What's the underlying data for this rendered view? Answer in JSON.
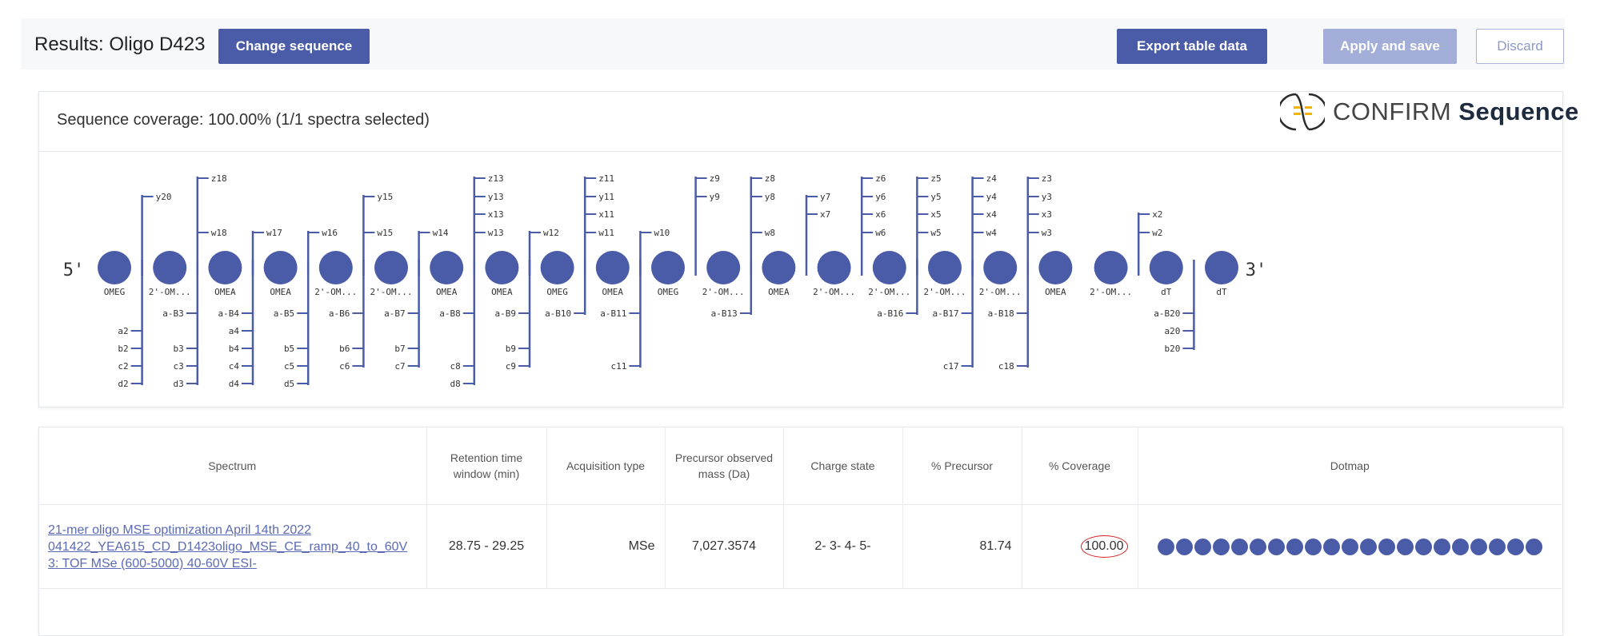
{
  "header": {
    "title": "Results: Oligo D423",
    "change_sequence_label": "Change sequence",
    "export_label": "Export table data",
    "apply_label": "Apply and save",
    "discard_label": "Discard"
  },
  "coverage": {
    "title": "Sequence coverage: 100.00% (1/1 spectra selected)",
    "end5": "5'",
    "end3": "3'"
  },
  "logo": {
    "word1": "CONFIRM",
    "word2": "Sequence"
  },
  "nucleotides": [
    {
      "label": "OMEG"
    },
    {
      "label": "2'-OM..."
    },
    {
      "label": "OMEA"
    },
    {
      "label": "OMEA"
    },
    {
      "label": "2'-OM..."
    },
    {
      "label": "2'-OM..."
    },
    {
      "label": "OMEA"
    },
    {
      "label": "OMEA"
    },
    {
      "label": "OMEG"
    },
    {
      "label": "OMEA"
    },
    {
      "label": "OMEG"
    },
    {
      "label": "2'-OM..."
    },
    {
      "label": "OMEA"
    },
    {
      "label": "2'-OM..."
    },
    {
      "label": "2'-OM..."
    },
    {
      "label": "2'-OM..."
    },
    {
      "label": "2'-OM..."
    },
    {
      "label": "OMEA"
    },
    {
      "label": "2'-OM..."
    },
    {
      "label": "dT"
    },
    {
      "label": "dT"
    }
  ],
  "links": [
    {
      "top": [
        "y20"
      ],
      "bottom": [
        "a2",
        "b2",
        "c2",
        "d2"
      ]
    },
    {
      "top": [
        "w18",
        "z18"
      ],
      "bottom": [
        "a-B3",
        "b3",
        "c3",
        "d3"
      ]
    },
    {
      "top": [
        "w17"
      ],
      "bottom": [
        "a-B4",
        "a4",
        "b4",
        "c4",
        "d4"
      ]
    },
    {
      "top": [
        "w16"
      ],
      "bottom": [
        "a-B5",
        "b5",
        "c5",
        "d5"
      ]
    },
    {
      "top": [
        "w15",
        "y15"
      ],
      "bottom": [
        "a-B6",
        "b6",
        "c6"
      ]
    },
    {
      "top": [
        "w14"
      ],
      "bottom": [
        "a-B7",
        "b7",
        "c7"
      ]
    },
    {
      "top": [
        "w13",
        "x13",
        "y13",
        "z13"
      ],
      "bottom": [
        "a-B8",
        "c8",
        "d8"
      ]
    },
    {
      "top": [
        "w12"
      ],
      "bottom": [
        "a-B9",
        "b9",
        "c9"
      ]
    },
    {
      "top": [
        "w11",
        "x11",
        "y11",
        "z11"
      ],
      "bottom": [
        "a-B10"
      ]
    },
    {
      "top": [
        "w10"
      ],
      "bottom": [
        "a-B11",
        "c11"
      ]
    },
    {
      "top": [
        "y9",
        "z9"
      ],
      "bottom": []
    },
    {
      "top": [
        "w8",
        "y8",
        "z8"
      ],
      "bottom": [
        "a-B13"
      ]
    },
    {
      "top": [
        "x7",
        "y7"
      ],
      "bottom": []
    },
    {
      "top": [
        "w6",
        "x6",
        "y6",
        "z6"
      ],
      "bottom": []
    },
    {
      "top": [
        "w5",
        "x5",
        "y5",
        "z5"
      ],
      "bottom": [
        "a-B16"
      ]
    },
    {
      "top": [
        "w4",
        "x4",
        "y4",
        "z4"
      ],
      "bottom": [
        "a-B17",
        "c17"
      ]
    },
    {
      "top": [
        "w3",
        "x3",
        "y3",
        "z3"
      ],
      "bottom": [
        "a-B18",
        "c18"
      ]
    },
    {
      "top": [],
      "bottom": []
    },
    {
      "top": [
        "w2",
        "x2"
      ],
      "bottom": []
    },
    {
      "top": [],
      "bottom": [
        "a-B20",
        "a20",
        "b20"
      ]
    }
  ],
  "table": {
    "headers": {
      "spectrum": "Spectrum",
      "retention": "Retention time window (min)",
      "acquisition": "Acquisition type",
      "precursor_mass": "Precursor observed mass (Da)",
      "charge": "Charge state",
      "pct_precursor": "% Precursor",
      "pct_coverage": "% Coverage",
      "dotmap": "Dotmap"
    },
    "row": {
      "spectrum": "21-mer oligo MSE optimization April 14th 2022 041422_YEA615_CD_D1423oligo_MSE_CE_ramp_40_to_60V 3: TOF MSe (600-5000) 40-60V ESI-",
      "retention": "28.75 - 29.25",
      "acquisition": "MSe",
      "precursor_mass": "7,027.3574",
      "charge": "2- 3- 4- 5-",
      "pct_precursor": "81.74",
      "pct_coverage": "100.00",
      "dotmap_count": 21
    }
  },
  "colors": {
    "accent": "#4a5ba8",
    "accent_disabled": "#a3aed8",
    "highlight": "#d21f1f",
    "logo_yellow": "#f2b400"
  }
}
